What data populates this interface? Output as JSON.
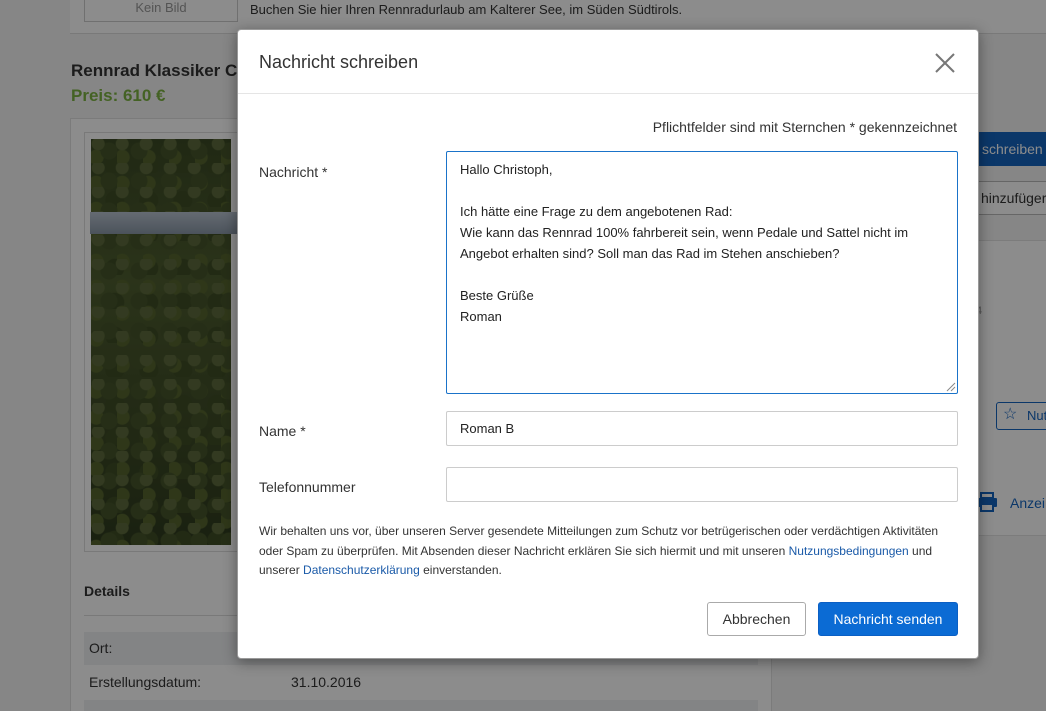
{
  "background": {
    "no_image_label": "Kein Bild",
    "promo_text": "Buchen Sie hier Ihren Rennradurlaub am Kalterer See, im Süden Südtirols.",
    "listing_title": "Rennrad Klassiker C",
    "price": "Preis: 610 €",
    "details_label": "Details",
    "details_rows": [
      {
        "key": "Ort:",
        "value": ""
      },
      {
        "key": "Erstellungsdatum:",
        "value": "31.10.2016"
      },
      {
        "key": "",
        "value": ""
      }
    ],
    "right_write_button": "schreiben",
    "right_add_button": "hinzufüger",
    "right_fav_button": "Nut",
    "right_print_link": "Anzei"
  },
  "modal": {
    "title": "Nachricht schreiben",
    "required_note": "Pflichtfelder sind mit Sternchen * gekennzeichnet",
    "message_label": "Nachricht *",
    "message_value": "Hallo Christoph,\n\nIch hätte eine Frage zu dem angebotenen Rad:\nWie kann das Rennrad 100% fahrbereit sein, wenn Pedale und Sattel nicht im Angebot erhalten sind? Soll man das Rad im Stehen anschieben?\n\nBeste Grüße\nRoman",
    "name_label": "Name *",
    "name_value": "Roman B",
    "phone_label": "Telefonnummer",
    "phone_value": "",
    "legal_part1": "Wir behalten uns vor, über unseren Server gesendete Mitteilungen zum Schutz vor betrügerischen oder verdächtigen Aktivitäten oder Spam zu überprüfen. Mit Absenden dieser Nachricht erklären Sie sich hiermit und mit unseren ",
    "legal_link_terms": "Nutzungsbedingungen",
    "legal_part2": " und unserer ",
    "legal_link_privacy": "Datenschutzerklärung",
    "legal_part3": " einverstanden.",
    "cancel_label": "Abbrechen",
    "send_label": "Nachricht senden"
  },
  "colors": {
    "primary": "#0b6bd4",
    "price_green": "#7cb342",
    "link": "#1a5aa8"
  }
}
